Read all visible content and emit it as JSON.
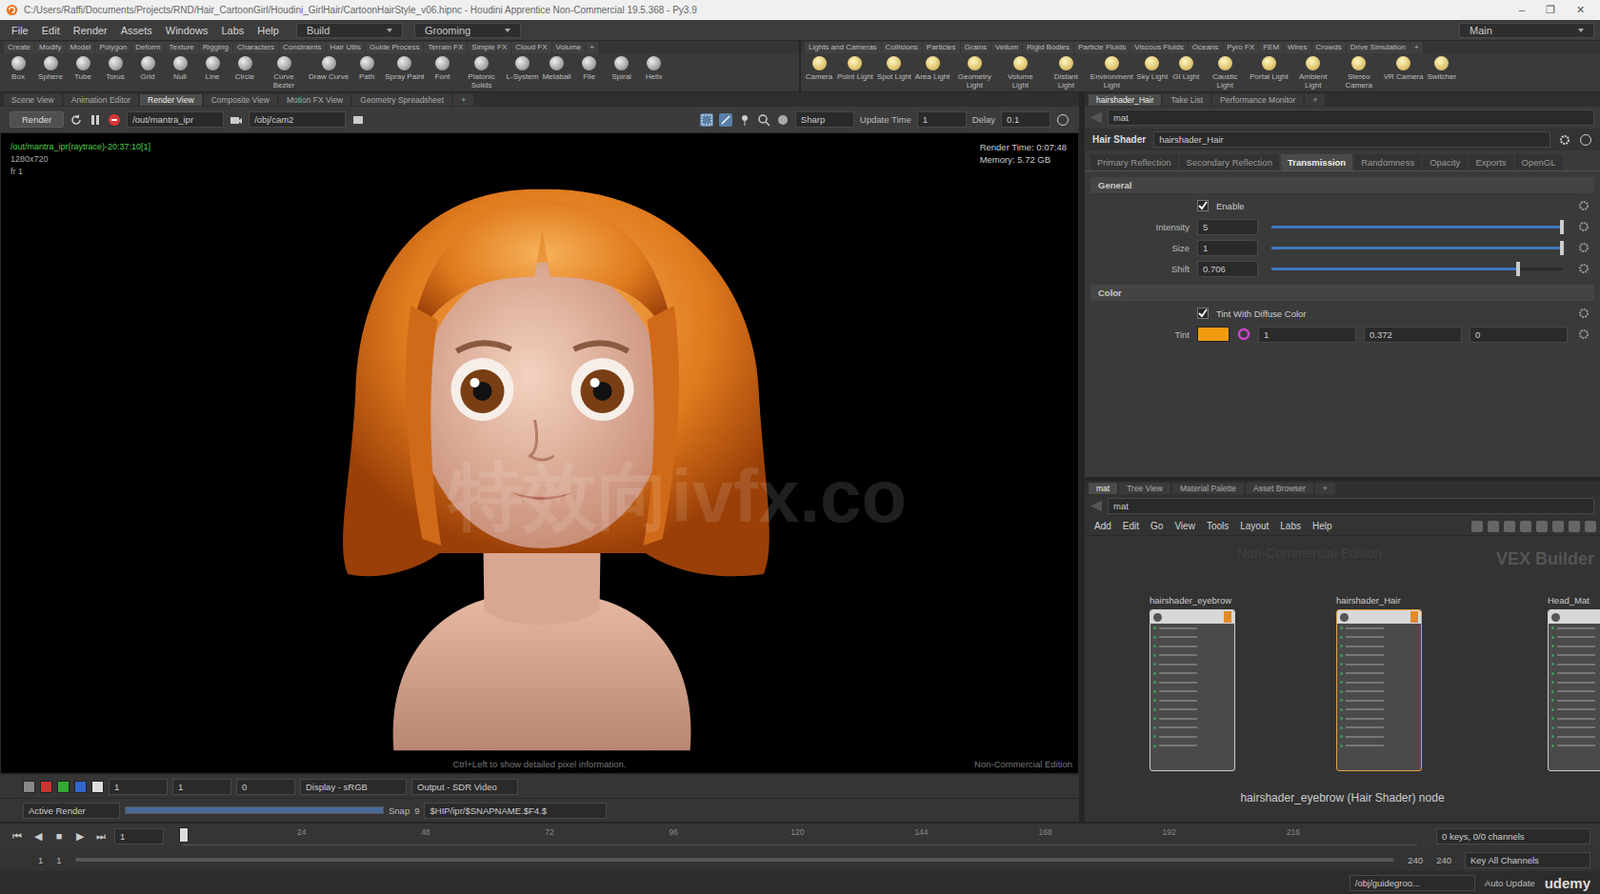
{
  "window": {
    "title": "C:/Users/Raffi/Documents/Projects/RND/Hair_CartoonGirl/Houdini_GirlHair/CartoonHairStyle_v06.hipnc - Houdini Apprentice Non-Commercial 19.5.368 - Py3.9",
    "controls": [
      "–",
      "❐",
      "✕"
    ]
  },
  "menu": [
    "File",
    "Edit",
    "Render",
    "Assets",
    "Windows",
    "Labs",
    "Help"
  ],
  "desktop": {
    "build": "Build",
    "grooming": "Grooming",
    "main": "Main"
  },
  "shelf_tabs_left": [
    "Create",
    "Modify",
    "Model",
    "Polygon",
    "Deform",
    "Texture",
    "Rigging",
    "Characters",
    "Constraints",
    "Hair Utils",
    "Guide Process",
    "Terrain FX",
    "Simple FX",
    "Cloud FX",
    "Volume"
  ],
  "shelf_tabs_right": [
    "Lights and Cameras",
    "Collisions",
    "Particles",
    "Grains",
    "Vellum",
    "Rigid Bodies",
    "Particle Fluids",
    "Viscous Fluids",
    "Oceans",
    "Pyro FX",
    "FEM",
    "Wires",
    "Crowds",
    "Drive Simulation"
  ],
  "shelf_tools_left": [
    "Box",
    "Sphere",
    "Tube",
    "Torus",
    "Grid",
    "Null",
    "Line",
    "Circle",
    "Curve Bezier",
    "Draw Curve",
    "Path",
    "Spray Paint",
    "Font",
    "Platonic Solids",
    "L-System",
    "Metaball",
    "File",
    "Spiral",
    "Helix"
  ],
  "shelf_tools_right": [
    "Camera",
    "Point Light",
    "Spot Light",
    "Area Light",
    "Geometry Light",
    "Volume Light",
    "Distant Light",
    "Environment Light",
    "Sky Light",
    "GI Light",
    "Caustic Light",
    "Portal Light",
    "Ambient Light",
    "Stereo Camera",
    "VR Camera",
    "Switcher"
  ],
  "pane_tabs": [
    {
      "label": "Scene View",
      "selected": false
    },
    {
      "label": "Animation Editor",
      "selected": false
    },
    {
      "label": "Render View",
      "selected": true
    },
    {
      "label": "Composite View",
      "selected": false
    },
    {
      "label": "Motion FX View",
      "selected": false
    },
    {
      "label": "Geometry Spreadsheet",
      "selected": false
    }
  ],
  "plus": "+",
  "render_toolbar": {
    "render": "Render",
    "rop": "/out/mantra_ipr",
    "camera": "/obj/cam2",
    "preview": "Sharp",
    "update_label": "Update Time",
    "update_value": "1",
    "delay_label": "Delay",
    "delay_value": "0.1"
  },
  "viewport": {
    "info": [
      "/out/mantra_ipr(raytrace)-20:37:10[1]",
      "1280x720",
      "fr 1"
    ],
    "stats": [
      "Render Time: 0:07:48",
      "Memory: 5.72 GB"
    ],
    "hint": "Ctrl+Left to show detailed pixel information.",
    "edition": "Non-Commercial Edition",
    "watermark": "特效向ivfx.co"
  },
  "viewport_bar": {
    "fields": [
      "1",
      "1",
      "0"
    ],
    "display": "Display - sRGB",
    "output": "Output - SDR Video"
  },
  "snapshot_bar": {
    "mode": "Active Render",
    "snap": "Snap",
    "snap_value": "9",
    "path": "$HIP/ipr/$SNAPNAME.$F4.$"
  },
  "param_pane": {
    "tabs": [
      {
        "label": "hairshader_Hair",
        "selected": true
      },
      {
        "label": "Take List",
        "selected": false
      },
      {
        "label": "Performance Monitor",
        "selected": false
      }
    ],
    "path": "mat",
    "node_type": "Hair Shader",
    "node_name": "hairshader_Hair",
    "folders": [
      {
        "label": "Primary Reflection",
        "selected": false
      },
      {
        "label": "Secondary Reflection",
        "selected": false
      },
      {
        "label": "Transmission",
        "selected": true
      },
      {
        "label": "Randomness",
        "selected": false
      },
      {
        "label": "Opacity",
        "selected": false
      },
      {
        "label": "Exports",
        "selected": false
      },
      {
        "label": "OpenGL",
        "selected": false
      }
    ],
    "sections": [
      {
        "title": "General",
        "rows": [
          {
            "kind": "toggle",
            "label": "Enable",
            "checked": true
          },
          {
            "kind": "slider",
            "label": "Intensity",
            "value": "5",
            "level": 1
          },
          {
            "kind": "slider",
            "label": "Size",
            "value": "1",
            "level": 1
          },
          {
            "kind": "slider",
            "label": "Shift",
            "value": "0.706",
            "level": 0.85
          }
        ]
      },
      {
        "title": "Color",
        "rows": [
          {
            "kind": "toggle",
            "label": "Tint With Diffuse Color",
            "checked": true
          },
          {
            "kind": "color",
            "label": "Tint",
            "color": "#f29a10",
            "values": [
              "1",
              "0.372",
              "0"
            ]
          }
        ]
      }
    ]
  },
  "network_pane": {
    "tabs": [
      {
        "label": "mat",
        "selected": true
      },
      {
        "label": "Tree View",
        "selected": false
      },
      {
        "label": "Material Palette",
        "selected": false
      },
      {
        "label": "Asset Browser",
        "selected": false
      }
    ],
    "path": "mat",
    "menu": [
      "Add",
      "Edit",
      "Go",
      "View",
      "Tools",
      "Layout",
      "Labs",
      "Help"
    ],
    "watermark": "Non-Commercial Edition",
    "context": "VEX Builder",
    "nodes": [
      {
        "name": "hairshader_eyebrow",
        "selected": false
      },
      {
        "name": "hairshader_Hair",
        "selected": true
      },
      {
        "name": "Head_Mat",
        "selected": false
      }
    ],
    "caption": "hairshader_eyebrow (Hair Shader) node"
  },
  "timeline": {
    "controls": [
      "⏮",
      "◀",
      "■",
      "▶",
      "⏭"
    ],
    "frame": "1",
    "ticks": [
      "24",
      "48",
      "72",
      "96",
      "120",
      "144",
      "168",
      "192",
      "216"
    ],
    "keys": "0 keys, 0/0 channels",
    "start": "1",
    "start2": "1",
    "end": "240",
    "end2": "240",
    "key_all": "Key All Channels"
  },
  "status": {
    "path": "/obj/guidegroo...",
    "auto": "Auto Update"
  },
  "brand": "udemy"
}
